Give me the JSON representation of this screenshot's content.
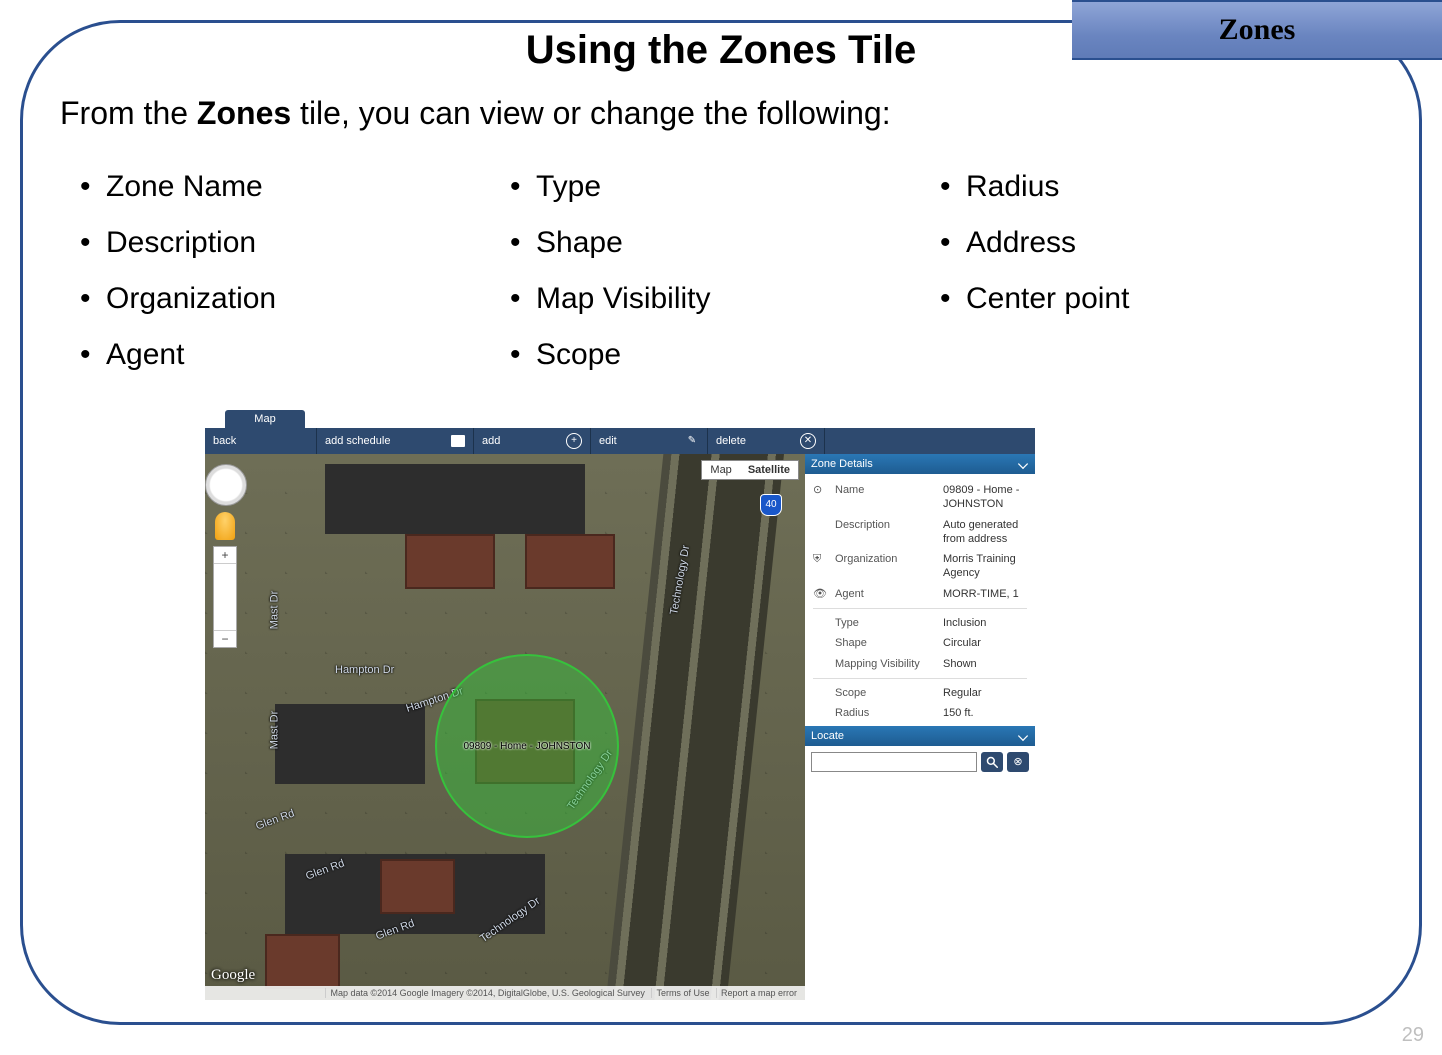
{
  "tab_label": "Zones",
  "title": "Using the Zones Tile",
  "intro_prefix": "From the ",
  "intro_bold": "Zones",
  "intro_suffix": " tile, you can view or change the following:",
  "bullets_col1": [
    "Zone Name",
    "Description",
    "Organization",
    "Agent"
  ],
  "bullets_col2": [
    "Type",
    "Shape",
    "Map Visibility",
    "Scope"
  ],
  "bullets_col3": [
    "Radius",
    "Address",
    "Center point"
  ],
  "page_number": "29",
  "app": {
    "tab": "Map",
    "toolbar": {
      "back": "back",
      "add_schedule": "add schedule",
      "add": "add",
      "edit": "edit",
      "delete": "delete"
    },
    "map_type": {
      "map": "Map",
      "satellite": "Satellite"
    },
    "route_shield": "40",
    "road_labels": {
      "mast": "Mast Dr",
      "hampton": "Hampton Dr",
      "technology": "Technology Dr",
      "glen": "Glen Rd"
    },
    "zone_label": "09809 - Home - JOHNSTON",
    "google": "Google",
    "footer": {
      "data": "Map data ©2014 Google Imagery ©2014, DigitalGlobe, U.S. Geological Survey",
      "terms": "Terms of Use",
      "report": "Report a map error"
    },
    "details_header": "Zone Details",
    "details": {
      "name_label": "Name",
      "name_value": "09809 - Home - JOHNSTON",
      "desc_label": "Description",
      "desc_value": "Auto generated from address",
      "org_label": "Organization",
      "org_value": "Morris Training Agency",
      "agent_label": "Agent",
      "agent_value": "MORR-TIME, 1",
      "type_label": "Type",
      "type_value": "Inclusion",
      "shape_label": "Shape",
      "shape_value": "Circular",
      "mapvis_label": "Mapping Visibility",
      "mapvis_value": "Shown",
      "scope_label": "Scope",
      "scope_value": "Regular",
      "radius_label": "Radius",
      "radius_value": "150  ft."
    },
    "locate_header": "Locate"
  }
}
